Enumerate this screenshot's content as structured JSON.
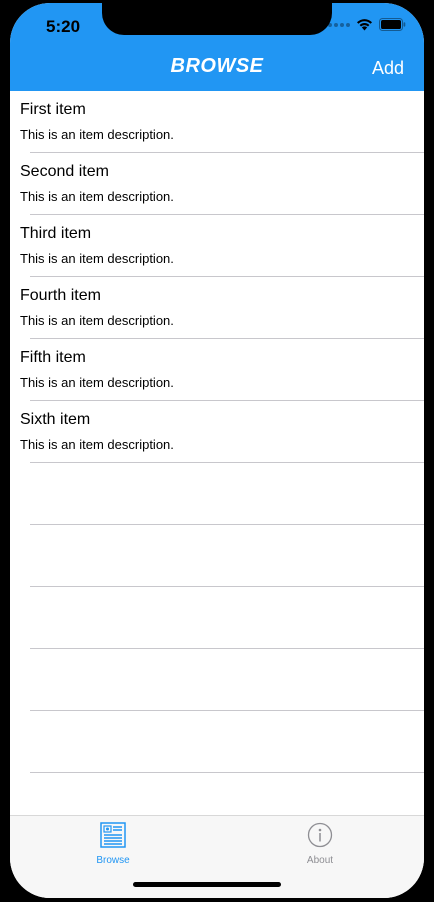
{
  "status_bar": {
    "time": "5:20"
  },
  "navbar": {
    "title": "BROWSE",
    "add_label": "Add",
    "color": "#2196F3"
  },
  "items": [
    {
      "title": "First item",
      "description": "This is an item description."
    },
    {
      "title": "Second item",
      "description": "This is an item description."
    },
    {
      "title": "Third item",
      "description": "This is an item description."
    },
    {
      "title": "Fourth item",
      "description": "This is an item description."
    },
    {
      "title": "Fifth item",
      "description": "This is an item description."
    },
    {
      "title": "Sixth item",
      "description": "This is an item description."
    }
  ],
  "tabbar": {
    "tabs": [
      {
        "label": "Browse",
        "icon": "browse-icon",
        "active": true
      },
      {
        "label": "About",
        "icon": "info-icon",
        "active": false
      }
    ]
  }
}
